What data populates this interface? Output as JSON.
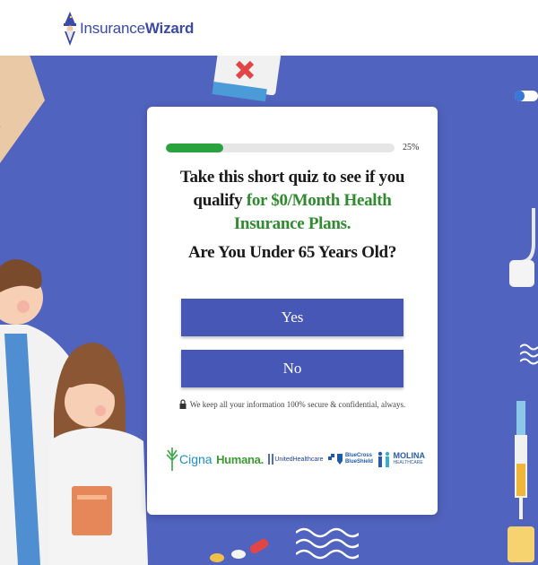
{
  "header": {
    "logo_prefix": "Insurance",
    "logo_suffix": "Wizard"
  },
  "quiz": {
    "progress_percent": 25,
    "progress_label": "25%",
    "headline_part1": "Take this short quiz to see if you qualify ",
    "headline_part2": "for $0/Month Health Insurance Plans.",
    "question": "Are You Under 65 Years Old?",
    "answers": [
      "Yes",
      "No"
    ],
    "secure_note": "We keep all your information 100% secure & confidential, always."
  },
  "brands": {
    "cigna": "Cigna",
    "humana": "Humana.",
    "uhc": "UnitedHealthcare",
    "bcbs_line1": "BlueCross",
    "bcbs_line2": "BlueShield",
    "molina_line1": "MOLINA",
    "molina_line2": "HEALTHCARE"
  },
  "colors": {
    "background": "#5063be",
    "button": "#4657b5",
    "progress": "#2aa33e",
    "accent_green": "#2e8b2e"
  },
  "icons": [
    "wizard-icon",
    "lock-icon",
    "cigna-tree-icon",
    "bcbs-icon",
    "molina-icon"
  ]
}
